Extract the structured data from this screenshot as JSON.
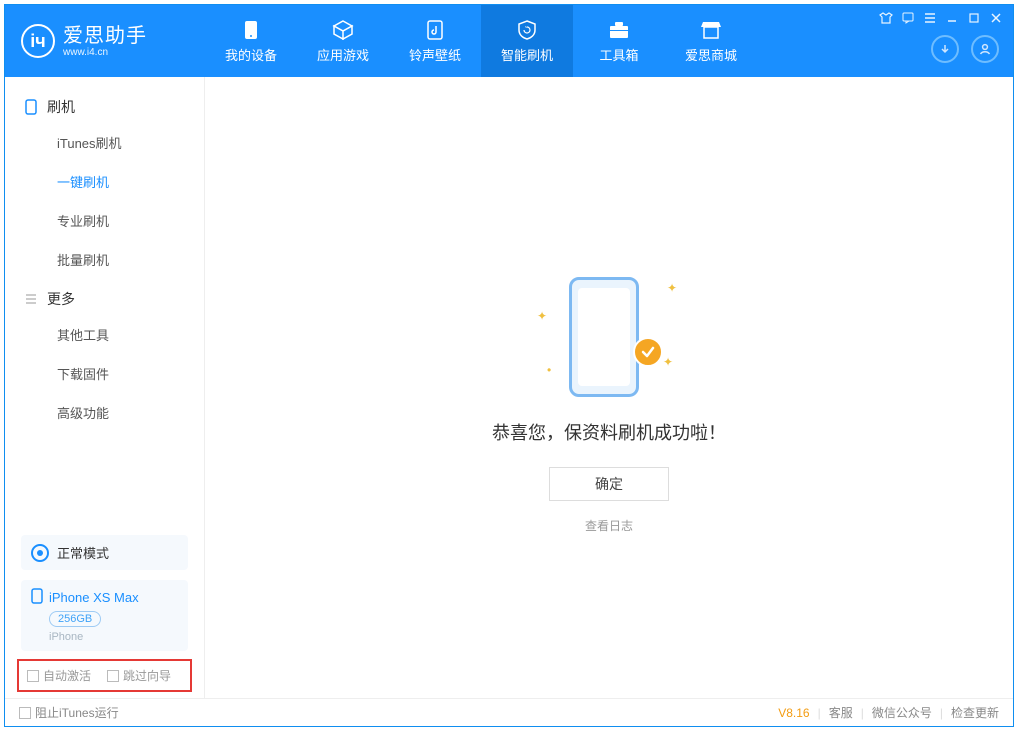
{
  "app": {
    "name_cn": "爱思助手",
    "domain": "www.i4.cn"
  },
  "nav_tabs": [
    {
      "label": "我的设备"
    },
    {
      "label": "应用游戏"
    },
    {
      "label": "铃声壁纸"
    },
    {
      "label": "智能刷机"
    },
    {
      "label": "工具箱"
    },
    {
      "label": "爱思商城"
    }
  ],
  "sidebar": {
    "section1": {
      "title": "刷机",
      "items": [
        "iTunes刷机",
        "一键刷机",
        "专业刷机",
        "批量刷机"
      ],
      "active_index": 1
    },
    "section2": {
      "title": "更多",
      "items": [
        "其他工具",
        "下载固件",
        "高级功能"
      ]
    },
    "mode": "正常模式",
    "device": {
      "name": "iPhone XS Max",
      "capacity": "256GB",
      "subtype": "iPhone"
    },
    "options": {
      "auto_activate": "自动激活",
      "skip_guide": "跳过向导"
    }
  },
  "main": {
    "success_text": "恭喜您，保资料刷机成功啦！",
    "ok_button": "确定",
    "view_log": "查看日志"
  },
  "statusbar": {
    "block_itunes": "阻止iTunes运行",
    "version": "V8.16",
    "support": "客服",
    "wechat": "微信公众号",
    "check_update": "检查更新"
  }
}
